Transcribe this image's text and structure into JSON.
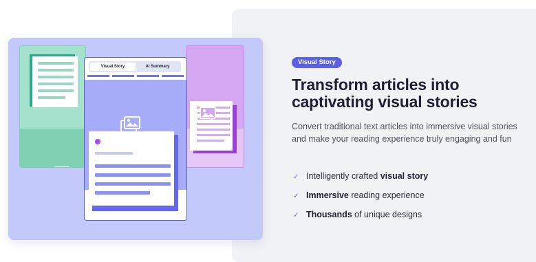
{
  "badge": "Visual Story",
  "heading": "Transform articles into captivating visual stories",
  "description": "Convert traditional text articles into immersive visual stories and make your reading experience truly engaging and fun",
  "features": [
    {
      "pre": "Intelligently crafted ",
      "bold": "visual story",
      "post": ""
    },
    {
      "pre": "",
      "bold": "Immersive",
      "post": " reading experience"
    },
    {
      "pre": "",
      "bold": "Thousands",
      "post": " of unique designs"
    }
  ],
  "phone": {
    "tabs": [
      "Visual Story",
      "AI Summary"
    ]
  },
  "icons": {
    "check": "check-icon",
    "image": "image-placeholder-icon"
  },
  "colors": {
    "accent": "#5b5fe6",
    "heading": "#1f2033",
    "text": "#4f5261",
    "illustration_bg": "#c4c9fb",
    "panel_bg": "#f1f2f5"
  }
}
